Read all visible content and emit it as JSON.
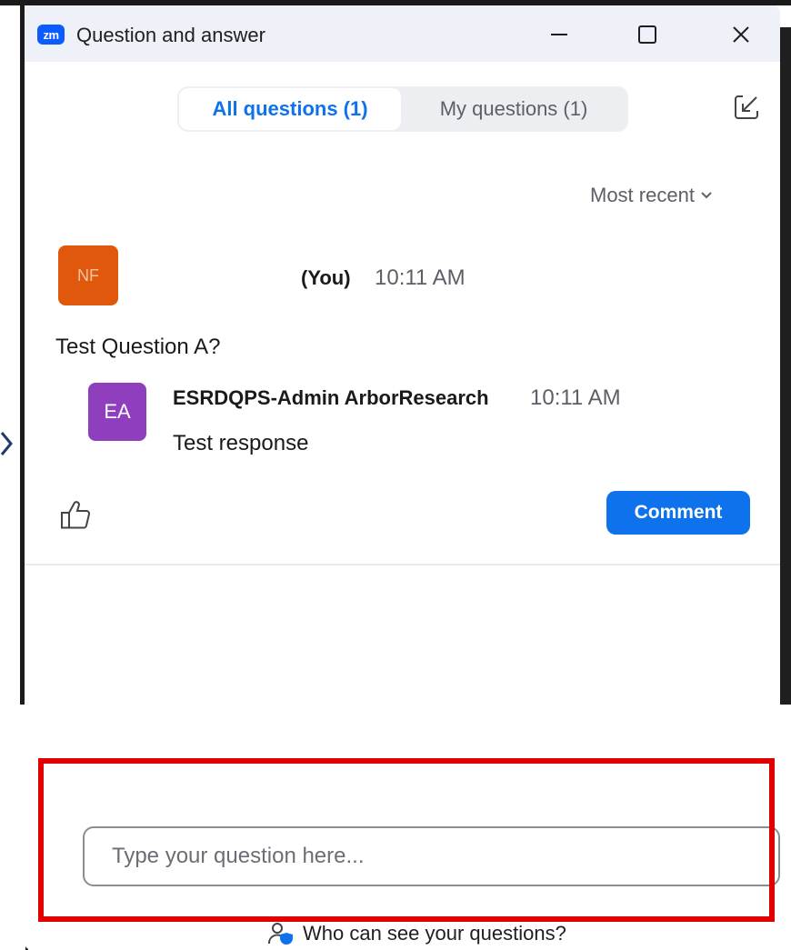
{
  "window": {
    "title": "Question and answer",
    "logo_text": "zm"
  },
  "tabs": [
    {
      "label": "All questions (1)",
      "active": true
    },
    {
      "label": "My questions (1)",
      "active": false
    }
  ],
  "sort": {
    "label": "Most recent"
  },
  "question": {
    "avatar_initials": "NF",
    "author_label": "(You)",
    "time": "10:11 AM",
    "text": "Test Question A?",
    "reply": {
      "avatar_initials": "EA",
      "author": "ESRDQPS-Admin ArborResearch",
      "time": "10:11 AM",
      "text": "Test response"
    },
    "comment_label": "Comment"
  },
  "composer": {
    "placeholder": "Type your question here...",
    "value": ""
  },
  "footer": {
    "who_label": "Who can see your questions?"
  },
  "colors": {
    "accent": "#0e72ed",
    "you_avatar": "#e0580c",
    "ea_avatar": "#8f3ebd",
    "highlight": "#e00000",
    "titlebar": "#eef1f8"
  }
}
